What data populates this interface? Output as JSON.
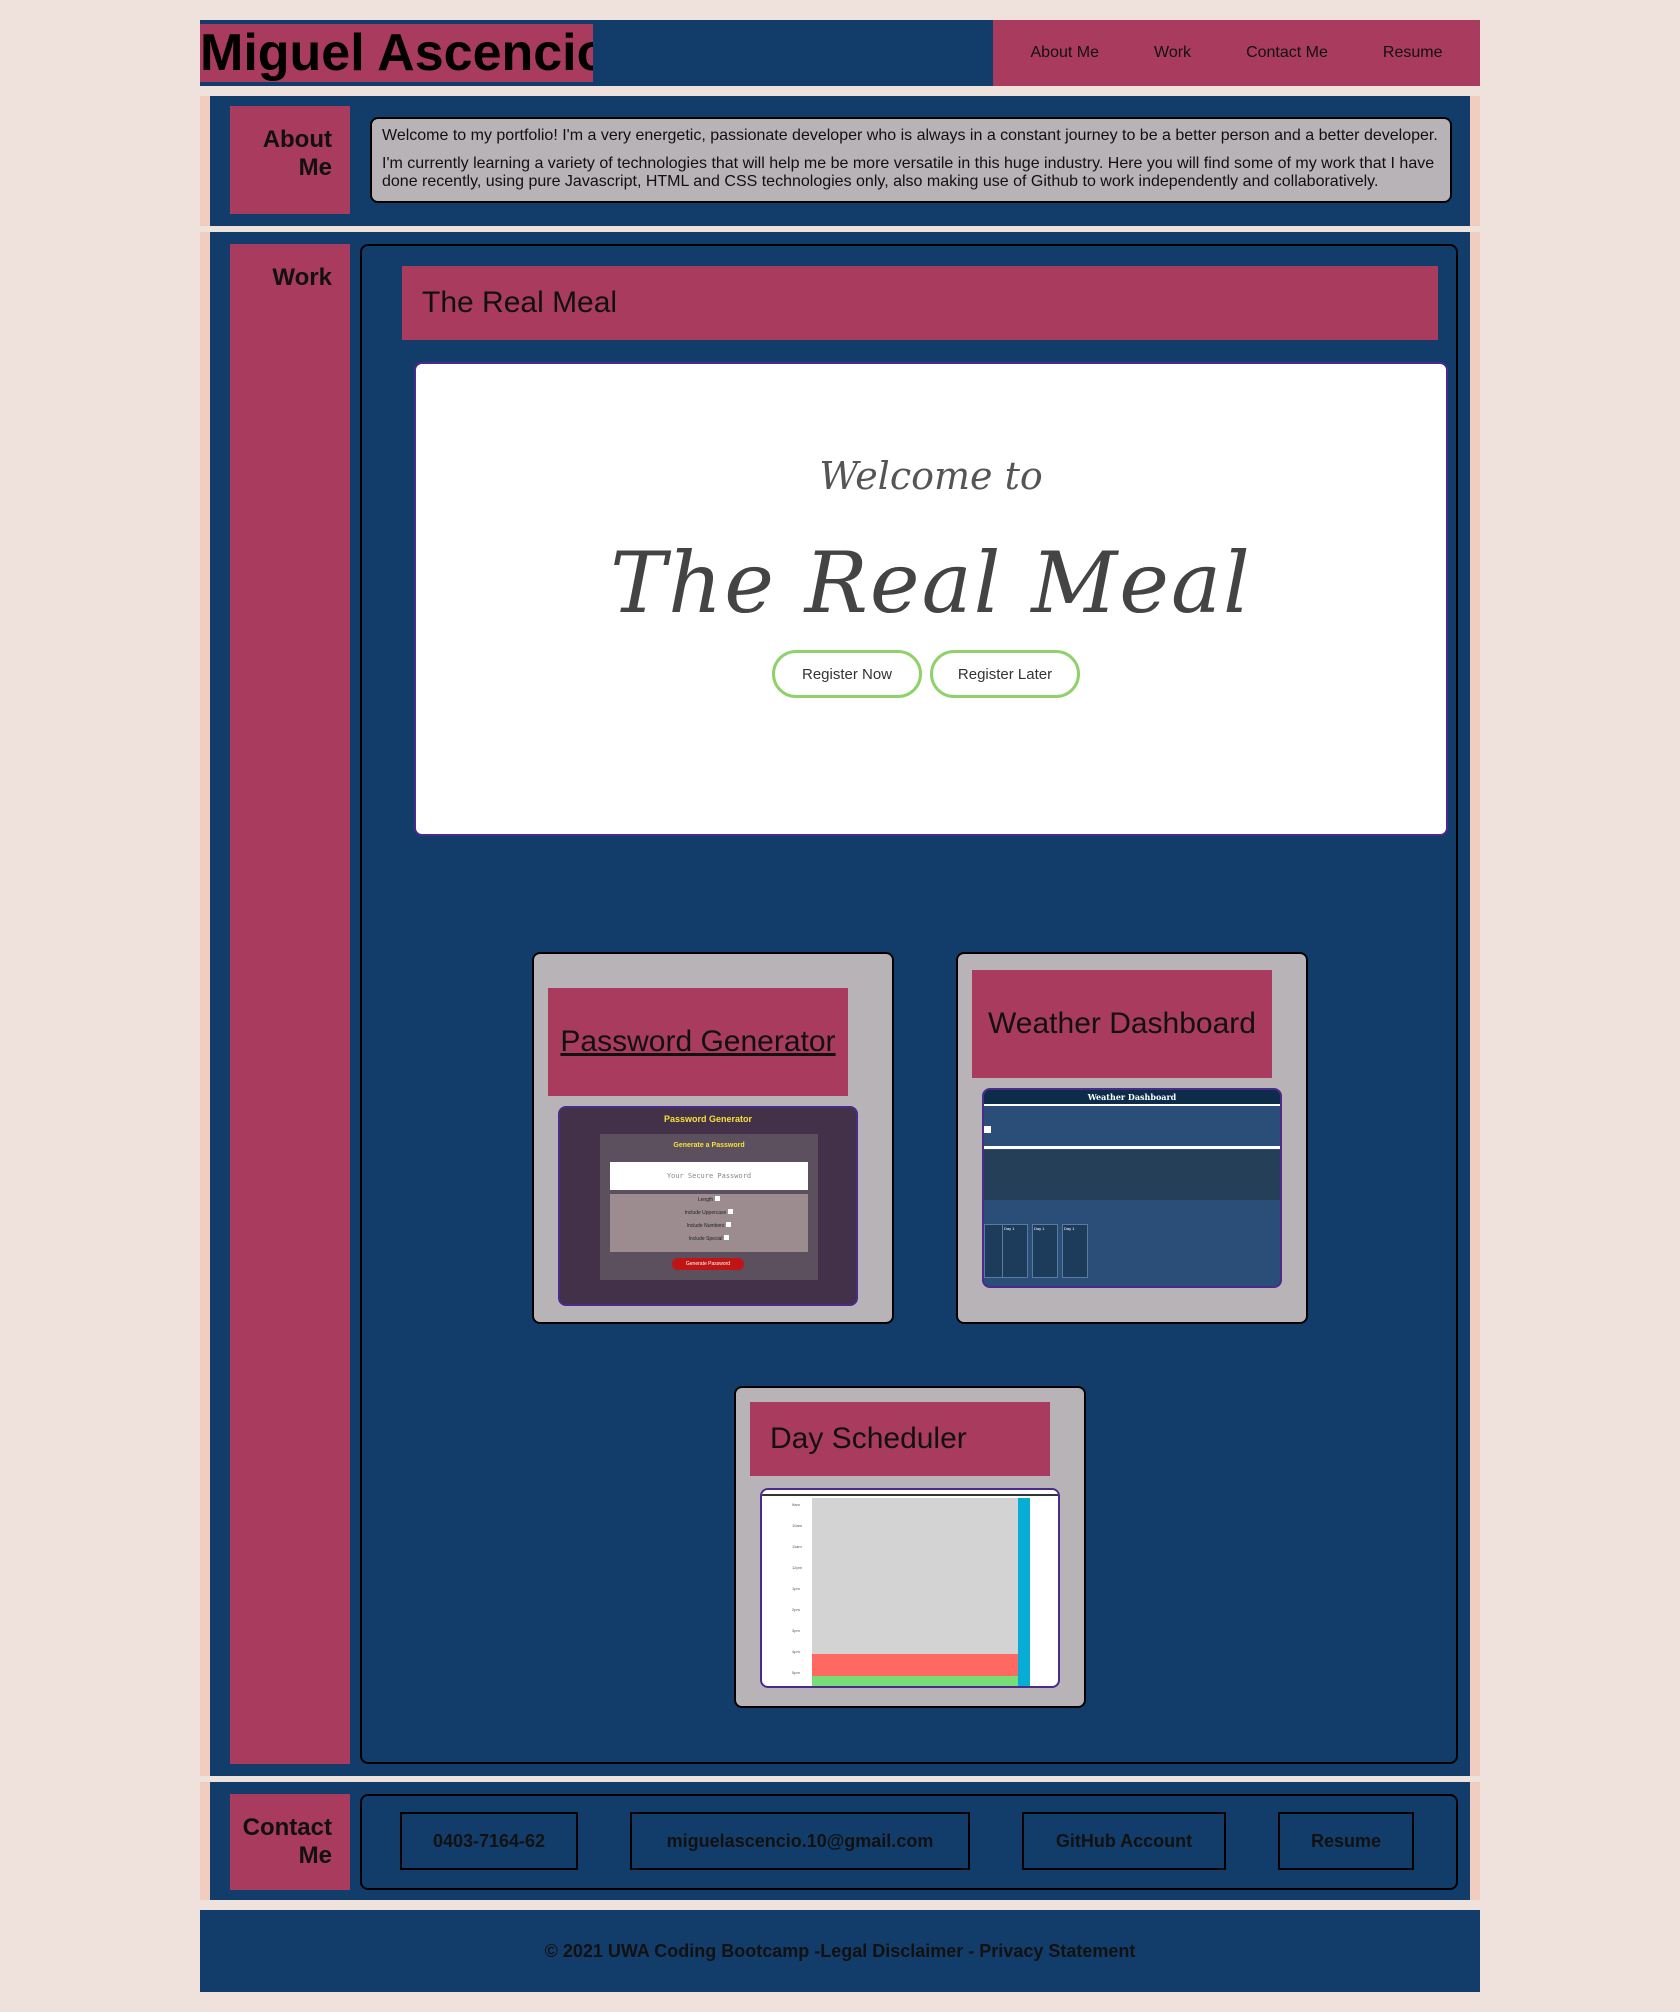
{
  "site_title": "Miguel Ascencio",
  "nav": [
    "About Me",
    "Work",
    "Contact Me",
    "Resume"
  ],
  "about": {
    "label": "About Me",
    "p1": "Welcome to my portfolio! I'm a very energetic, passionate developer who is always in a constant journey to be a better person and a better developer.",
    "p2": "I'm currently learning a variety of technologies that will help me be more versatile in this huge industry. Here you will find some of my work that I have done recently, using pure Javascript, HTML and CSS technologies only, also making use of Github to work independently and collaboratively."
  },
  "work": {
    "label": "Work",
    "featured": {
      "title": "The Real Meal",
      "shot_welcome": "Welcome to",
      "shot_logo": "The Real Meal",
      "shot_btn1": "Register Now",
      "shot_btn2": "Register Later"
    },
    "projects": [
      {
        "title": "Password Generator",
        "shot_header": "Password Generator",
        "shot_sub": "Generate a Password",
        "shot_placeholder": "Your Secure Password",
        "shot_opts": [
          "Length",
          "Include Uppercase",
          "Include Numbers",
          "Include Special"
        ],
        "shot_btn": "Generate Password"
      },
      {
        "title": "Weather Dashboard",
        "shot_header": "Weather Dashboard",
        "shot_day": "Day 1"
      },
      {
        "title": "Day Scheduler",
        "shot_hours": [
          "9am",
          "10am",
          "11am",
          "12pm",
          "1pm",
          "2pm",
          "3pm",
          "4pm",
          "5pm"
        ]
      }
    ]
  },
  "contact": {
    "label": "Contact Me",
    "phone": "0403-7164-62",
    "email": "miguelascencio.10@gmail.com",
    "github": "GitHub Account",
    "resume": "Resume"
  },
  "footer": "© 2021 UWA Coding Bootcamp -Legal Disclaimer - Privacy Statement",
  "colors": {
    "navy": "#123d6b",
    "rose": "#a93b5f",
    "peach": "#f0cdbf",
    "background": "#efe2dc",
    "card": "#b8b3b6"
  }
}
